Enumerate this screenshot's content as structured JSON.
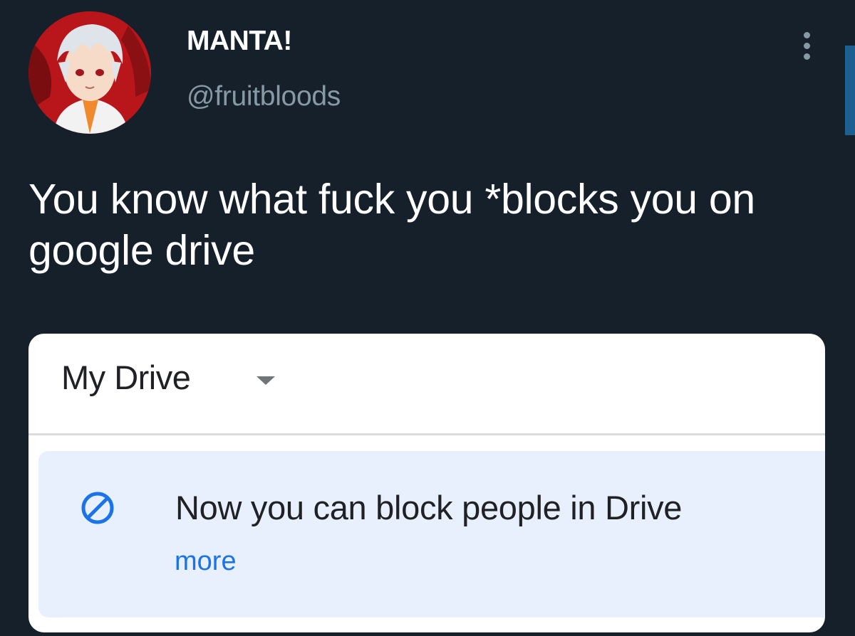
{
  "tweet": {
    "author": {
      "display_name": "MANTA!",
      "handle": "@fruitbloods",
      "avatar_icon": "profile-avatar"
    },
    "menu_icon": "more-vertical-icon",
    "text": "You know what fuck you *blocks you on google drive"
  },
  "embedded_screenshot": {
    "header": {
      "title": "My Drive",
      "dropdown_icon": "caret-down-icon"
    },
    "notice": {
      "icon": "block-icon",
      "message": "Now you can block people in Drive",
      "link_label": "more"
    }
  },
  "colors": {
    "background": "#15202b",
    "secondary_text": "#8899a6",
    "notice_background": "#e8f0fe",
    "accent_blue": "#1a73e8"
  }
}
